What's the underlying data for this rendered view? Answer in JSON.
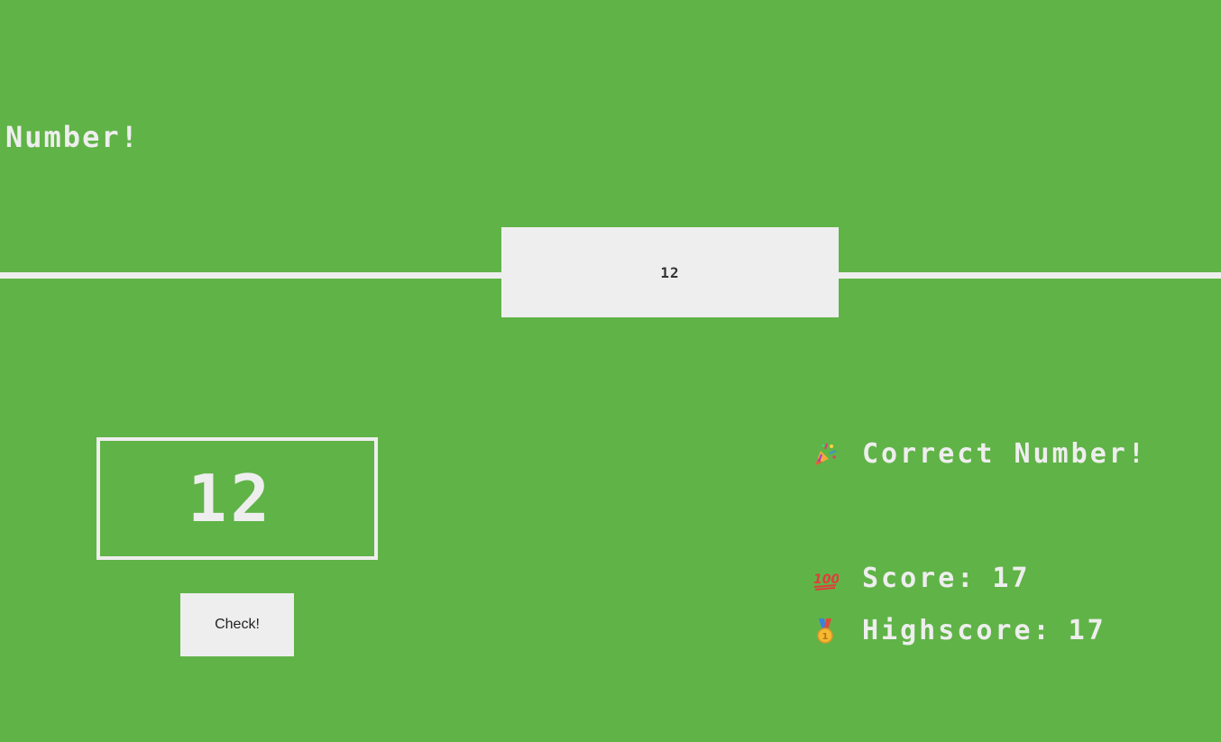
{
  "header": {
    "title": "Number!"
  },
  "game": {
    "secret_number": "12",
    "guess_value": "12",
    "check_label": "Check!"
  },
  "stats": {
    "message": "Correct Number!",
    "message_icon": "party-popper-icon",
    "score_label": "Score:",
    "score_value": "17",
    "score_icon": "hundred-points-icon",
    "highscore_label": "Highscore:",
    "highscore_value": "17",
    "highscore_icon": "medal-icon"
  },
  "colors": {
    "background": "#60b347",
    "foreground": "#eeeeee",
    "box_text": "#333333"
  }
}
